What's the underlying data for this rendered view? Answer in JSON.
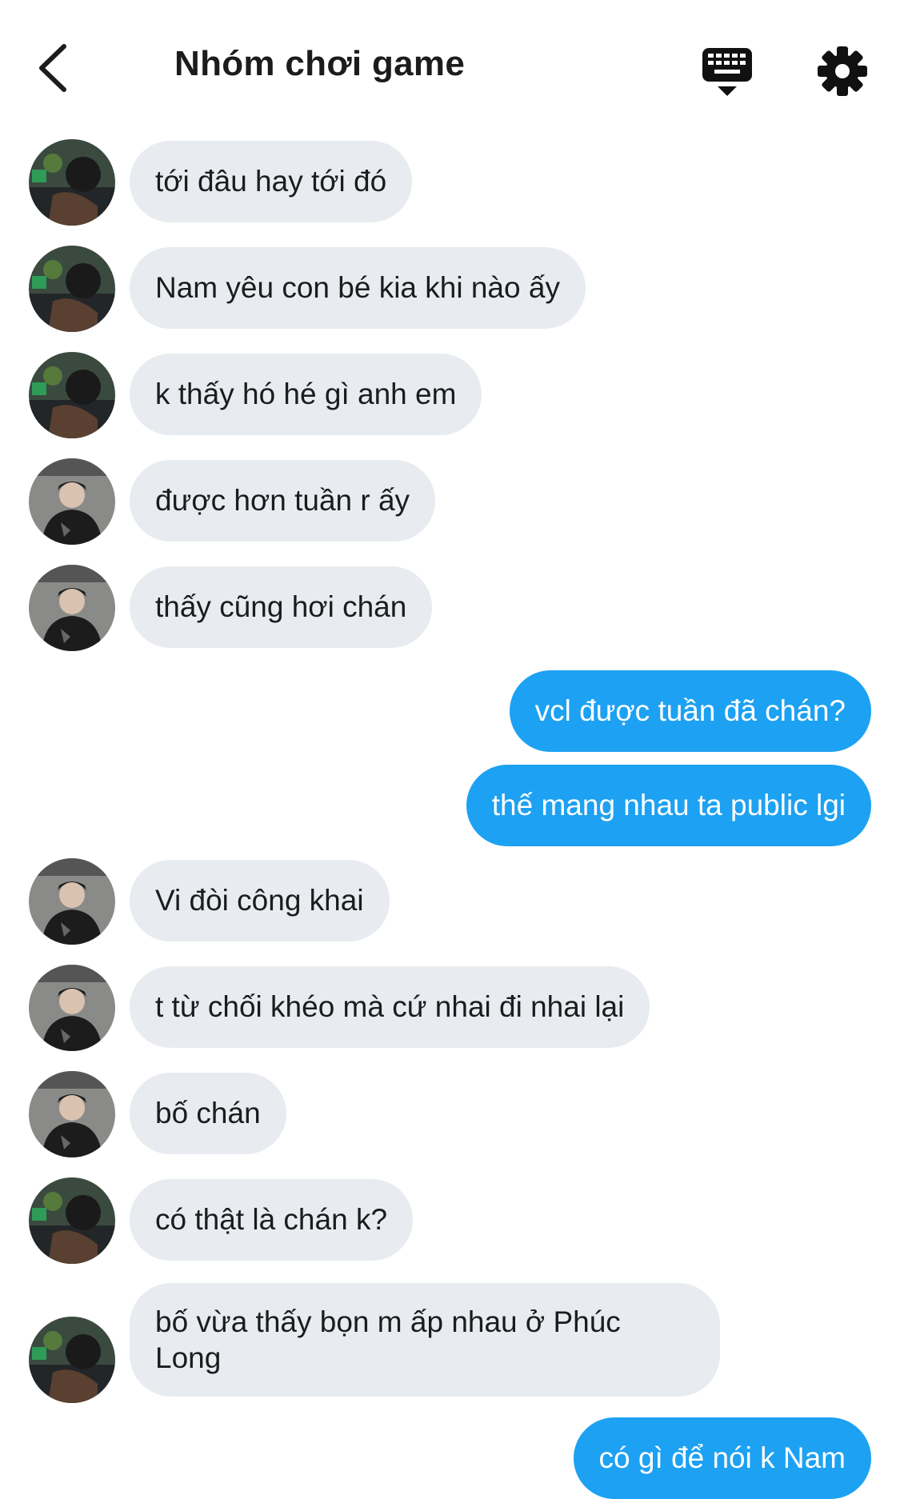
{
  "header": {
    "title": "Nhóm chơi game",
    "icons": [
      "chevron-left-icon",
      "keyboard-icon",
      "gear-icon"
    ]
  },
  "colors": {
    "incoming_bubble": "#e8ecf0",
    "outgoing_bubble": "#1da1f2",
    "text": "#1c1c1e"
  },
  "messages": [
    {
      "direction": "in",
      "sender": "a",
      "text": "tới đâu hay tới đó"
    },
    {
      "direction": "in",
      "sender": "a",
      "text": "Nam yêu con bé kia khi nào ấy"
    },
    {
      "direction": "in",
      "sender": "a",
      "text": "k thấy hó hé gì anh em"
    },
    {
      "direction": "in",
      "sender": "b",
      "text": "được hơn tuần r ấy"
    },
    {
      "direction": "in",
      "sender": "b",
      "text": "thấy cũng hơi chán"
    },
    {
      "direction": "out",
      "text": "vcl được tuần đã chán?"
    },
    {
      "direction": "out",
      "text": "thế mang nhau ta public lgi"
    },
    {
      "direction": "in",
      "sender": "b",
      "text": "Vi đòi công khai"
    },
    {
      "direction": "in",
      "sender": "b",
      "text": "t từ chối khéo mà cứ nhai đi nhai lại"
    },
    {
      "direction": "in",
      "sender": "b",
      "text": "bố chán"
    },
    {
      "direction": "in",
      "sender": "a",
      "text": "có thật là chán k?"
    },
    {
      "direction": "in",
      "sender": "a",
      "text": "bố vừa thấy bọn m ấp nhau ở Phúc Long"
    },
    {
      "direction": "out",
      "text": "có gì để nói k Nam"
    }
  ]
}
